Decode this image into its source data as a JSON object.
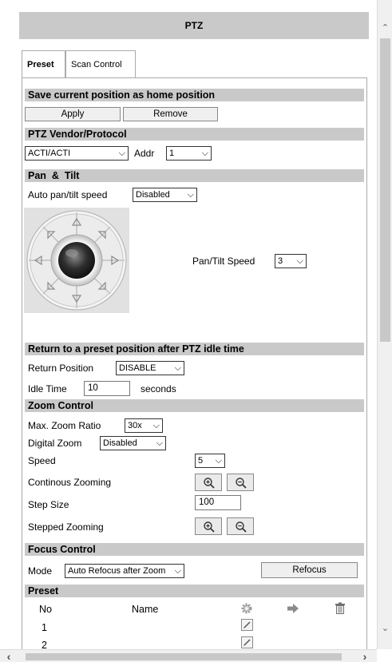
{
  "header": {
    "title": "PTZ"
  },
  "tabs": [
    {
      "label": "Preset",
      "active": true
    },
    {
      "label": "Scan Control",
      "active": false
    }
  ],
  "home": {
    "section_title": "Save current position as home position",
    "apply_label": "Apply",
    "remove_label": "Remove"
  },
  "vendor": {
    "section_title": "PTZ Vendor/Protocol",
    "protocol_value": "ACTI/ACTI",
    "addr_label": "Addr",
    "addr_value": "1"
  },
  "pantilt": {
    "section_title": "Pan  &  Tilt",
    "auto_speed_label": "Auto pan/tilt speed",
    "auto_speed_value": "Disabled",
    "speed_label": "Pan/Tilt Speed",
    "speed_value": "3"
  },
  "idle": {
    "section_title": "Return to a preset position after PTZ idle time",
    "return_label": "Return Position",
    "return_value": "DISABLE",
    "idle_label": "Idle Time",
    "idle_value": "10",
    "unit": "seconds"
  },
  "zoom": {
    "section_title": "Zoom Control",
    "max_ratio_label": "Max. Zoom Ratio",
    "max_ratio_value": "30x",
    "digital_label": "Digital Zoom",
    "digital_value": "Disabled",
    "speed_label": "Speed",
    "speed_value": "5",
    "continuous_label": "Continous Zooming",
    "step_size_label": "Step Size",
    "step_size_value": "100",
    "stepped_label": "Stepped Zooming"
  },
  "focus": {
    "section_title": "Focus Control",
    "mode_label": "Mode",
    "mode_value": "Auto Refocus after Zoom",
    "refocus_label": "Refocus"
  },
  "preset": {
    "section_title": "Preset",
    "col_no": "No",
    "col_name": "Name",
    "rows": [
      {
        "no": "1"
      },
      {
        "no": "2"
      }
    ]
  },
  "icons": {
    "gear": "gear-icon",
    "goto": "arrow-right-icon",
    "delete": "trash-icon",
    "edit": "edit-icon"
  },
  "colors": {
    "section_bg": "#c9c9c9",
    "joystick_bg": "#e1e1e1"
  }
}
